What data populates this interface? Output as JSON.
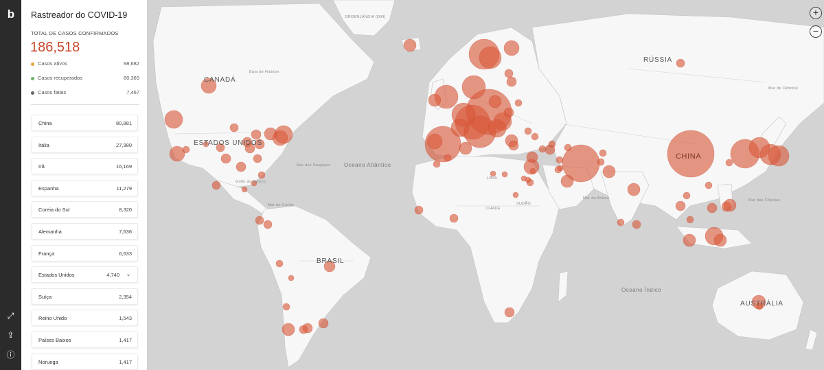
{
  "app": {
    "title": "Rastreador do COVID-19",
    "logo_icon": "bing-logo-icon"
  },
  "summary": {
    "total_label": "TOTAL DE CASOS CONFIRMADOS",
    "total_value": "186,518",
    "stats": [
      {
        "label": "Casos ativos",
        "value": "98,682",
        "color": "#e8a33d"
      },
      {
        "label": "Casos recuperados",
        "value": "80,369",
        "color": "#6fb56b"
      },
      {
        "label": "Casos fatais",
        "value": "7,467",
        "color": "#666666"
      }
    ]
  },
  "countries": [
    {
      "name": "China",
      "value": "80,881"
    },
    {
      "name": "Itália",
      "value": "27,980"
    },
    {
      "name": "Irã",
      "value": "16,169"
    },
    {
      "name": "Espanha",
      "value": "11,279"
    },
    {
      "name": "Coreia do Sul",
      "value": "8,320"
    },
    {
      "name": "Alemanha",
      "value": "7,636"
    },
    {
      "name": "França",
      "value": "6,633"
    },
    {
      "name": "Estados Unidos",
      "value": "4,740",
      "expandable": true
    },
    {
      "name": "Suíça",
      "value": "2,354"
    },
    {
      "name": "Reino Unido",
      "value": "1,543"
    },
    {
      "name": "Países Baixos",
      "value": "1,417"
    },
    {
      "name": "Noruega",
      "value": "1,417"
    }
  ],
  "rail_icons": [
    "expand-icon",
    "share-icon",
    "info-icon"
  ],
  "map": {
    "bubble_color": "#d9583a",
    "labels": {
      "canada": "CANADÁ",
      "usa": "ESTADOS UNIDOS",
      "brazil": "BRASIL",
      "russia": "RÚSSIA",
      "china": "CHINA",
      "australia": "AUSTRÁLIA",
      "atlantic": "Oceano Atlântico",
      "indian": "Oceano Índico",
      "sargasso": "Mar dos Sargaços",
      "caribbean": "Mar do Caribe",
      "arabian": "Mar da Arábia",
      "philippine": "Mar das Filipinas",
      "okhotsk": "Mar de Okhotsk",
      "greenland": "GROENLÂNDIA (DIN)",
      "hudson": "Baía de Hudson",
      "libya": "LÍBIA",
      "chad": "CHADE",
      "sudan": "SUDÃO",
      "mexico_gulf": "Golfo do México"
    },
    "zoom_in": "+",
    "zoom_out": "−"
  }
}
